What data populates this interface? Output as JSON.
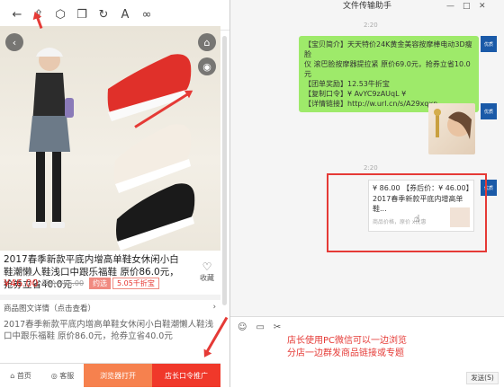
{
  "toolbar": {
    "icons": [
      "back-icon",
      "share-icon",
      "cube-icon",
      "copy-icon",
      "refresh-icon",
      "font-icon",
      "link-icon"
    ]
  },
  "product": {
    "title": "2017春季新款平底内增高单鞋女休闲小白鞋潮懒人鞋浅口中跟乐福鞋 原价86.0元，抢券立省40.0元",
    "price": "¥46.00",
    "original_price": "原价 ¥86.00",
    "coupon_label": "约选",
    "discount": "5.05千折宝",
    "favorite_label": "收藏",
    "detail_label": "商品图文详情（点击查看）",
    "description": "2017春季新款平底内增高单鞋女休闲小白鞋潮懒人鞋浅口中跟乐福鞋 原价86.0元，抢券立省40.0元"
  },
  "bottom_bar": {
    "home": "首页",
    "service": "客服",
    "browser_open": "浏览器打开",
    "promote": "店长口令推广"
  },
  "chat": {
    "window_title": "文件传输助手",
    "time1": "2:20",
    "time2": "2:20",
    "message_lines": [
      "【宝贝简介】天天特价24K黄金美容按摩棒电动3D瘦脸",
      "仪 滚巴脸按摩器提拉紧 原价69.0元，抢券立省10.0",
      "元",
      "【团单奖励】12.53牛折宝",
      "【复制口令】¥ AvYC9zAUqL ¥",
      "【详情链接】http://w.url.cn/s/A29xqxn"
    ],
    "card": {
      "price_line": "¥ 86.00 【券后价：¥ 46.00】",
      "title": "2017春季新款平底内增高单鞋...",
      "meta": "商品价格，原价 x优惠"
    },
    "avatar_label": "优质",
    "note_line1": "店长使用PC微信可以一边浏览",
    "note_line2": "分店一边群发商品链接或专题",
    "send_label": "发送(S)"
  },
  "colors": {
    "accent_red": "#e53a36",
    "bubble_green": "#9eea6a",
    "orange_btn": "#f6814e",
    "red_btn": "#f0382a"
  }
}
